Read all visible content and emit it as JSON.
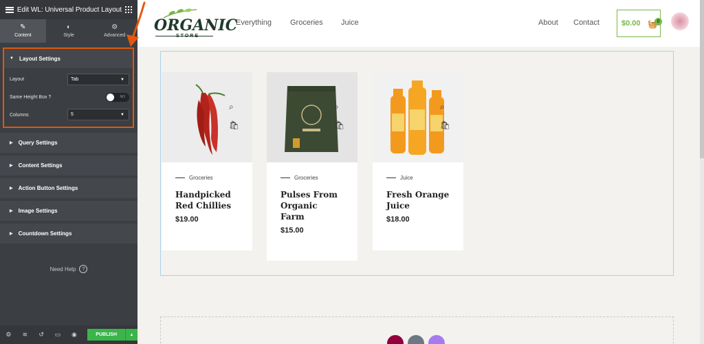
{
  "editor": {
    "title": "Edit WL: Universal Product Layout",
    "tabs": [
      {
        "label": "Content",
        "icon": "pencil-icon"
      },
      {
        "label": "Style",
        "icon": "half-circle-icon"
      },
      {
        "label": "Advanced",
        "icon": "gear-icon"
      }
    ],
    "layout_settings": {
      "heading": "Layout Settings",
      "layout_label": "Layout",
      "layout_value": "Tab",
      "same_height_label": "Same Height Box ?",
      "same_height_toggle_text": "NO",
      "columns_label": "Columns",
      "columns_value": "5"
    },
    "sections": [
      "Query Settings",
      "Content Settings",
      "Action Button Settings",
      "Image Settings",
      "Countdown Settings"
    ],
    "need_help": "Need Help",
    "publish_label": "PUBLISH"
  },
  "site": {
    "logo_word": "ORGANIC",
    "logo_sub": "STORE",
    "nav": [
      "Everything",
      "Groceries",
      "Juice"
    ],
    "nav_right": [
      "About",
      "Contact"
    ],
    "cart_total": "$0.00",
    "cart_count": "0"
  },
  "products": [
    {
      "category": "Groceries",
      "name": "Handpicked Red Chillies",
      "price": "$19.00"
    },
    {
      "category": "Groceries",
      "name": "Pulses From Organic Farm",
      "price": "$15.00"
    },
    {
      "category": "Juice",
      "name": "Fresh Orange Juice",
      "price": "$18.00"
    }
  ],
  "colors": {
    "accent_orange": "#e4570c",
    "publish_green": "#39b54a",
    "brand_green": "#7ab648"
  }
}
